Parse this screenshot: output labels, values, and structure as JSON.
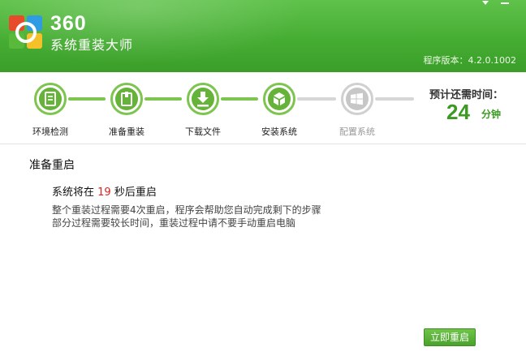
{
  "header": {
    "brand_num": "360",
    "brand_name": "系统重装大师",
    "version": "程序版本：4.2.0.1002",
    "colors": {
      "brand_green": "#46ad33",
      "accent_green": "#3b9a22"
    }
  },
  "window_controls": {
    "minimize_icon": "chevron-down-icon",
    "close_icon": "minimize-dash-icon"
  },
  "steps": [
    {
      "label": "环境检测",
      "status": "done",
      "icon": "document-icon"
    },
    {
      "label": "准备重装",
      "status": "done",
      "icon": "package-icon"
    },
    {
      "label": "下载文件",
      "status": "done",
      "icon": "download-icon"
    },
    {
      "label": "安装系统",
      "status": "done",
      "icon": "box-icon"
    },
    {
      "label": "配置系统",
      "status": "pending",
      "icon": "windows-icon"
    }
  ],
  "eta": {
    "label": "预计还需时间：",
    "value": "24",
    "unit": "分钟"
  },
  "main": {
    "title": "准备重启",
    "countdown_prefix": "系统将在",
    "countdown_value": "19",
    "countdown_suffix": "秒后重启",
    "desc_line1": "整个重装过程需要4次重启，程序会帮助您自动完成剩下的步骤",
    "desc_line2": "部分过程需要较长时间，重装过程中请不要手动重启电脑"
  },
  "actions": {
    "restart_now": "立即重启"
  }
}
